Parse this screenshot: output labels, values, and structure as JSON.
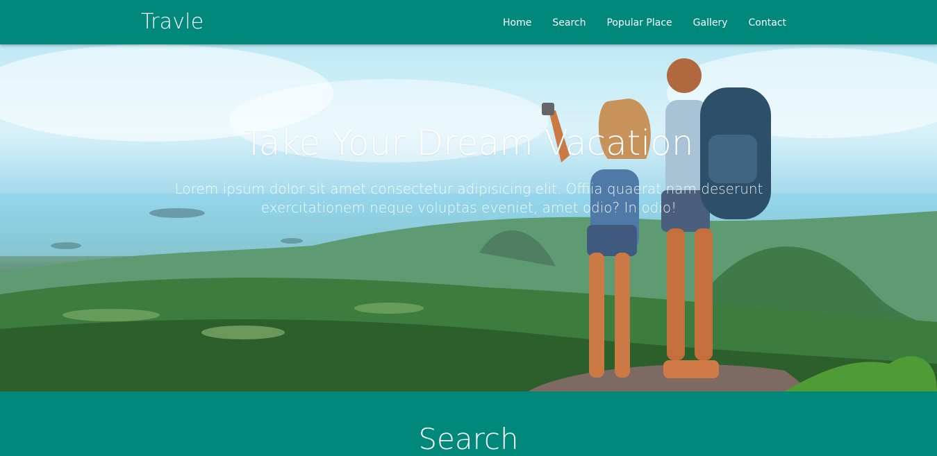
{
  "navbar": {
    "brand": "Travle",
    "items": [
      {
        "label": "Home"
      },
      {
        "label": "Search"
      },
      {
        "label": "Popular Place"
      },
      {
        "label": "Gallery"
      },
      {
        "label": "Contact"
      }
    ]
  },
  "hero": {
    "title": "Take Your Dream Vacation",
    "text": "Lorem ipsum dolor sit amet consectetur adipisicing elit. Offiia quaerat nam deserunt exercitationem neque voluptas eveniet, amet odio? In odio!"
  },
  "search_section": {
    "title": "Search"
  },
  "colors": {
    "primary": "#00897b",
    "text": "#ffffff"
  }
}
